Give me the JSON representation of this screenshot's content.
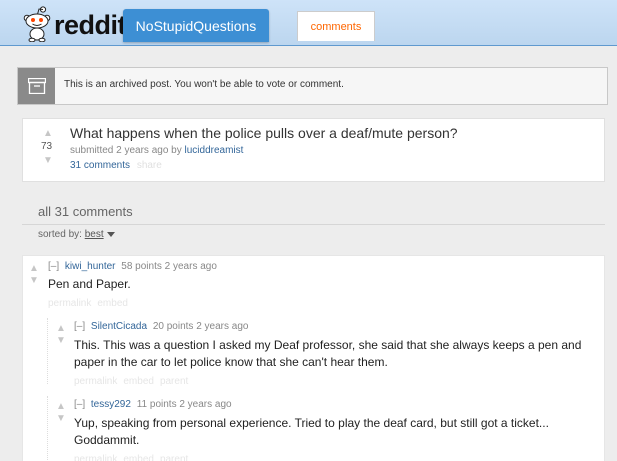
{
  "header": {
    "wordmark": "reddit",
    "subreddit": "NoStupidQuestions",
    "tab_label": "comments"
  },
  "archived": {
    "message": "This is an archived post. You won't be able to vote or comment."
  },
  "post": {
    "score": "73",
    "title": "What happens when the police pulls over a deaf/mute person?",
    "tagline_prefix": "submitted 2 years ago by ",
    "author": "luciddreamist",
    "comments_link": "31 comments",
    "share": "share"
  },
  "comment_area": {
    "heading": "all 31 comments",
    "sorted_label": "sorted by:",
    "sort_value": "best"
  },
  "comments": [
    {
      "collapse": "[–]",
      "author": "kiwi_hunter",
      "meta": "58 points 2 years ago",
      "body": "Pen and Paper.",
      "links": [
        "permalink",
        "embed"
      ]
    },
    {
      "collapse": "[–]",
      "author": "SilentCicada",
      "meta": "20 points 2 years ago",
      "body": "This. This was a question I asked my Deaf professor, she said that she always keeps a pen and paper in the car to let police know that she can't hear them.",
      "links": [
        "permalink",
        "embed",
        "parent"
      ]
    },
    {
      "collapse": "[–]",
      "author": "tessy292",
      "meta": "11 points 2 years ago",
      "body": "Yup, speaking from personal experience. Tried to play the deaf card, but still got a ticket... Goddammit.",
      "links": [
        "permalink",
        "embed",
        "parent"
      ]
    }
  ],
  "colors": {
    "header_bg": "#cee3f8",
    "subreddit_btn": "#3d8fd4",
    "tab_text": "#ff6600",
    "link": "#336699"
  },
  "icons": [
    "reddit-alien-logo",
    "archive-box-icon",
    "upvote-arrow-icon",
    "downvote-arrow-icon",
    "chevron-down-icon"
  ]
}
